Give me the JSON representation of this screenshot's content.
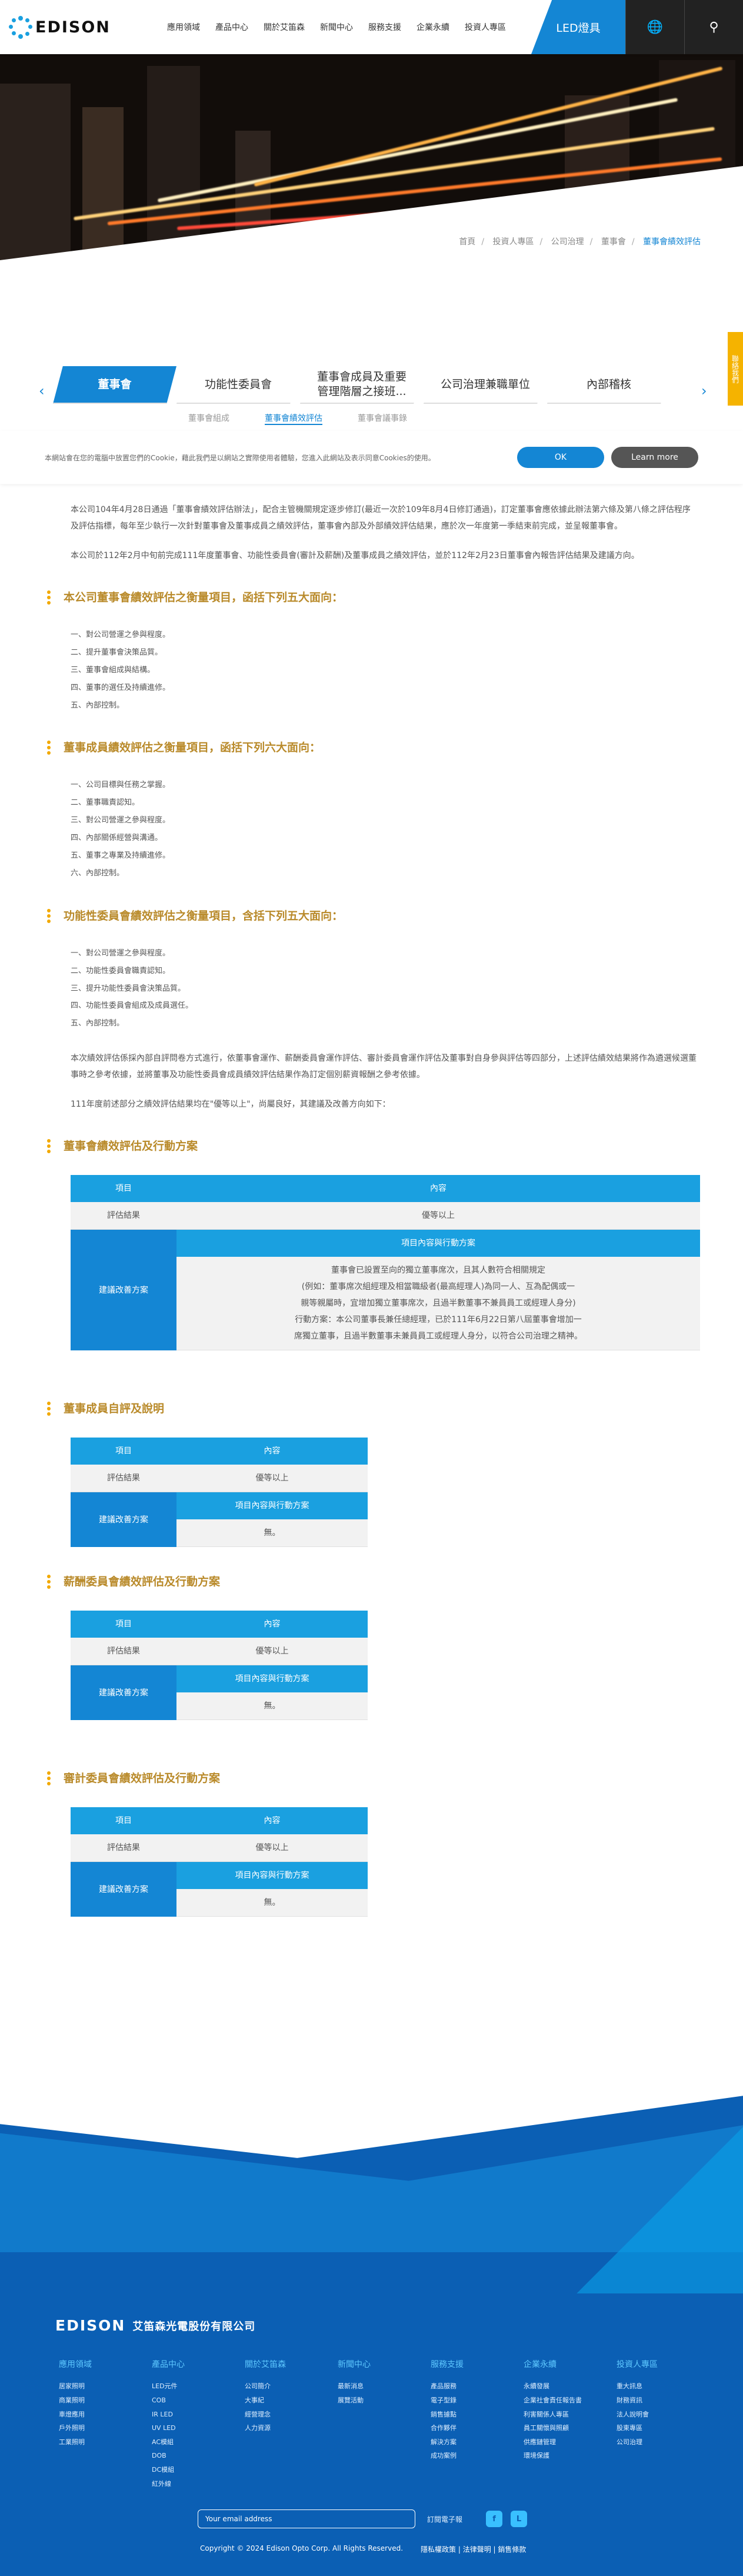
{
  "header": {
    "logo": "EDISON",
    "nav": [
      "應用領域",
      "產品中心",
      "關於艾笛森",
      "新聞中心",
      "服務支援",
      "企業永續",
      "投資人專區"
    ],
    "led_button": "LED燈具"
  },
  "breadcrumb": [
    "首頁",
    "投資人專區",
    "公司治理",
    "董事會",
    "董事會績效評估"
  ],
  "tabs": [
    "董事會",
    "功能性委員會",
    "董事會成員及重要管理階層之接班...",
    "公司治理兼職單位",
    "內部稽核"
  ],
  "subtabs": [
    "董事會組成",
    "董事會績效評估",
    "董事會議事錄"
  ],
  "side_tag": "聯絡我們",
  "cookie": {
    "text": "本網站會在您的電腦中放置您們的Cookie，藉此我們是以網站之實際使用者體驗，您進入此網站及表示同意Cookies的使用。",
    "ok": "OK",
    "more": "Learn more"
  },
  "intro": [
    "本公司104年4月28日通過「董事會績效評估辦法」，配合主管機關規定逐步修訂(最近一次於109年8月4日修訂通過)，訂定董事會應依據此辦法第六條及第八條之評估程序及評估指標，每年至少執行一次針對董事會及董事成員之績效評估，董事會內部及外部績效評估結果，應於次一年度第一季結束前完成，並呈報董事會。",
    "本公司於112年2月中旬前完成111年度董事會、功能性委員會(審計及薪酬)及董事成員之績效評估，並於112年2月23日董事會內報告評估結果及建議方向。"
  ],
  "sections": {
    "s1": {
      "title": "本公司董事會績效評估之衡量項目，函括下列五大面向：",
      "items": [
        "一、對公司營運之參與程度。",
        "二、提升董事會決策品質。",
        "三、董事會組成與結構。",
        "四、董事的選任及持續進修。",
        "五、內部控制。"
      ]
    },
    "s2": {
      "title": "董事成員績效評估之衡量項目，函括下列六大面向：",
      "items": [
        "一、公司目標與任務之掌握。",
        "二、董事職責認知。",
        "三、對公司營運之參與程度。",
        "四、內部關係經營與溝通。",
        "五、董事之專業及持續進修。",
        "六、內部控制。"
      ]
    },
    "s3": {
      "title": "功能性委員會績效評估之衡量項目，含括下列五大面向：",
      "items": [
        "一、對公司營運之參與程度。",
        "二、功能性委員會職責認知。",
        "三、提升功能性委員會決策品質。",
        "四、功能性委員會組成及成員選任。",
        "五、內部控制。"
      ]
    }
  },
  "middle_paras": [
    "本次績效評估係採內部自評問卷方式進行，依董事會運作、薪酬委員會運作評估、審計委員會運作評估及董事對自身參與評估等四部分，上述評估績效結果將作為遴選候選董事時之參考依據，並將董事及功能性委員會成員績效評估結果作為訂定個別薪資報酬之參考依據。",
    "111年度前述部分之績效評估結果均在\"優等以上\"，尚屬良好，其建議及改善方向如下："
  ],
  "table_main": {
    "title": "董事會績效評估及行動方案",
    "col_item": "項目",
    "col_content": "內容",
    "row_result_label": "評估結果",
    "row_result_value": "優等以上",
    "row_suggest_label": "建議改善方案",
    "action_header": "項目內容與行動方案",
    "actions": [
      "董事會已設置至向的獨立董事席次，且其人數符合相關規定",
      "(例如：董事席次組經理及相當職級者(最高經理人)為同一人、互為配偶或一",
      "親等親屬時，宜增加獨立董事席次，且過半數董事不兼員員工或經理人身分)",
      "行動方案：本公司董事長兼任總經理，已於111年6月22日第八屆董事會增加一",
      "席獨立董事，且過半數董事未兼員員工或經理人身分，以符合公司治理之精神。"
    ]
  },
  "small_tables": [
    {
      "title": "董事成員自評及說明",
      "col_item": "項目",
      "col_content": "內容",
      "result_label": "評估結果",
      "result_value": "優等以上",
      "suggest_label": "建議改善方案",
      "action_header": "項目內容與行動方案",
      "action_value": "無。"
    },
    {
      "title": "薪酬委員會績效評估及行動方案",
      "col_item": "項目",
      "col_content": "內容",
      "result_label": "評估結果",
      "result_value": "優等以上",
      "suggest_label": "建議改善方案",
      "action_header": "項目內容與行動方案",
      "action_value": "無。"
    },
    {
      "title": "審計委員會績效評估及行動方案",
      "col_item": "項目",
      "col_content": "內容",
      "result_label": "評估結果",
      "result_value": "優等以上",
      "suggest_label": "建議改善方案",
      "action_header": "項目內容與行動方案",
      "action_value": "無。"
    }
  ],
  "footer": {
    "logo": "EDISON",
    "company": "艾笛森光電股份有限公司",
    "columns": [
      {
        "title": "應用領域",
        "items": [
          "居家照明",
          "商業照明",
          "車燈應用",
          "戶外照明",
          "工業照明"
        ]
      },
      {
        "title": "產品中心",
        "items": [
          "LED元件",
          "COB",
          "IR LED",
          "UV LED",
          "AC模組",
          "DOB",
          "DC模組",
          "紅外線"
        ]
      },
      {
        "title": "關於艾笛森",
        "items": [
          "公司簡介",
          "大事紀",
          "經營理念",
          "人力資源"
        ]
      },
      {
        "title": "新聞中心",
        "items": [
          "最新消息",
          "展覽活動"
        ]
      },
      {
        "title": "服務支援",
        "items": [
          "產品服務",
          "電子型錄",
          "銷售據點",
          "合作夥伴",
          "解決方案",
          "成功案例"
        ]
      },
      {
        "title": "企業永續",
        "items": [
          "永續發展",
          "企業社會責任報告書",
          "利害關係人專區",
          "員工關懷與照顧",
          "供應鏈管理",
          "環境保護"
        ]
      },
      {
        "title": "投資人專區",
        "items": [
          "重大訊息",
          "財務資訊",
          "法人說明會",
          "股東專區",
          "公司治理"
        ]
      }
    ],
    "email_placeholder": "Your email address",
    "subscribe": "訂閱電子報",
    "social": [
      "f",
      "L"
    ],
    "copyright": "Copyright © 2024 Edison Opto Corp. All Rights Reserved.",
    "links": "隱私權政策 | 法律聲明 | 銷售條款"
  }
}
